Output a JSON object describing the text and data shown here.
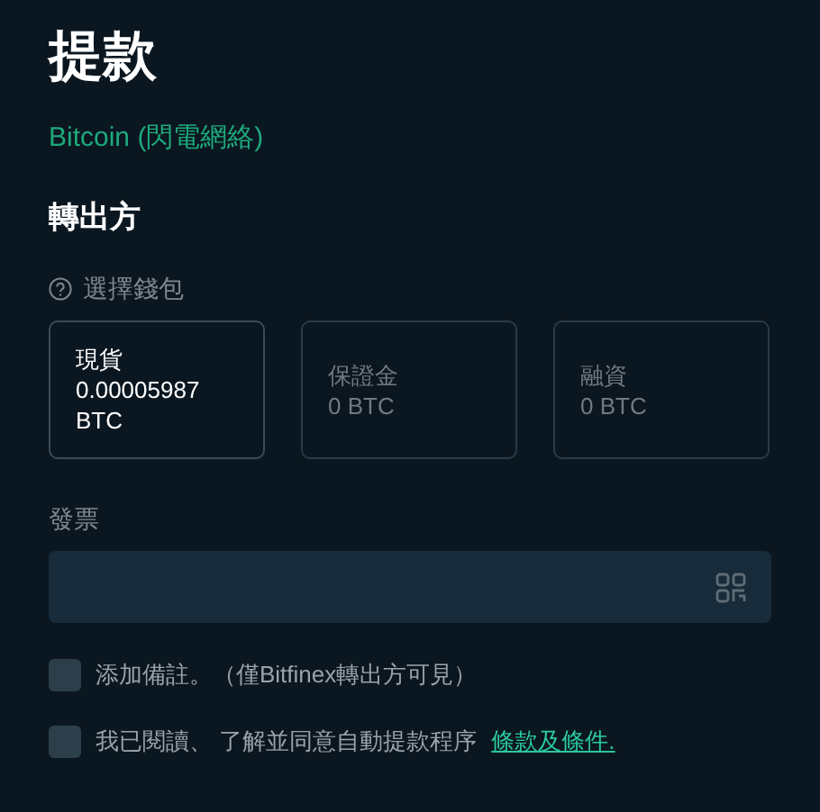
{
  "title": "提款",
  "network": "Bitcoin (閃電網絡)",
  "section_title": "轉出方",
  "wallet_label": "選擇錢包",
  "wallets": [
    {
      "name": "現貨",
      "amount": "0.00005987 BTC",
      "selected": true
    },
    {
      "name": "保證金",
      "amount": "0 BTC",
      "selected": false
    },
    {
      "name": "融資",
      "amount": "0 BTC",
      "selected": false
    }
  ],
  "invoice": {
    "label": "發票"
  },
  "options": [
    {
      "label": "添加備註。（僅Bitfinex轉出方可見）",
      "checked": false
    },
    {
      "label": "我已閱讀、 了解並同意自動提款程序",
      "link": "條款及條件.",
      "checked": false
    }
  ]
}
